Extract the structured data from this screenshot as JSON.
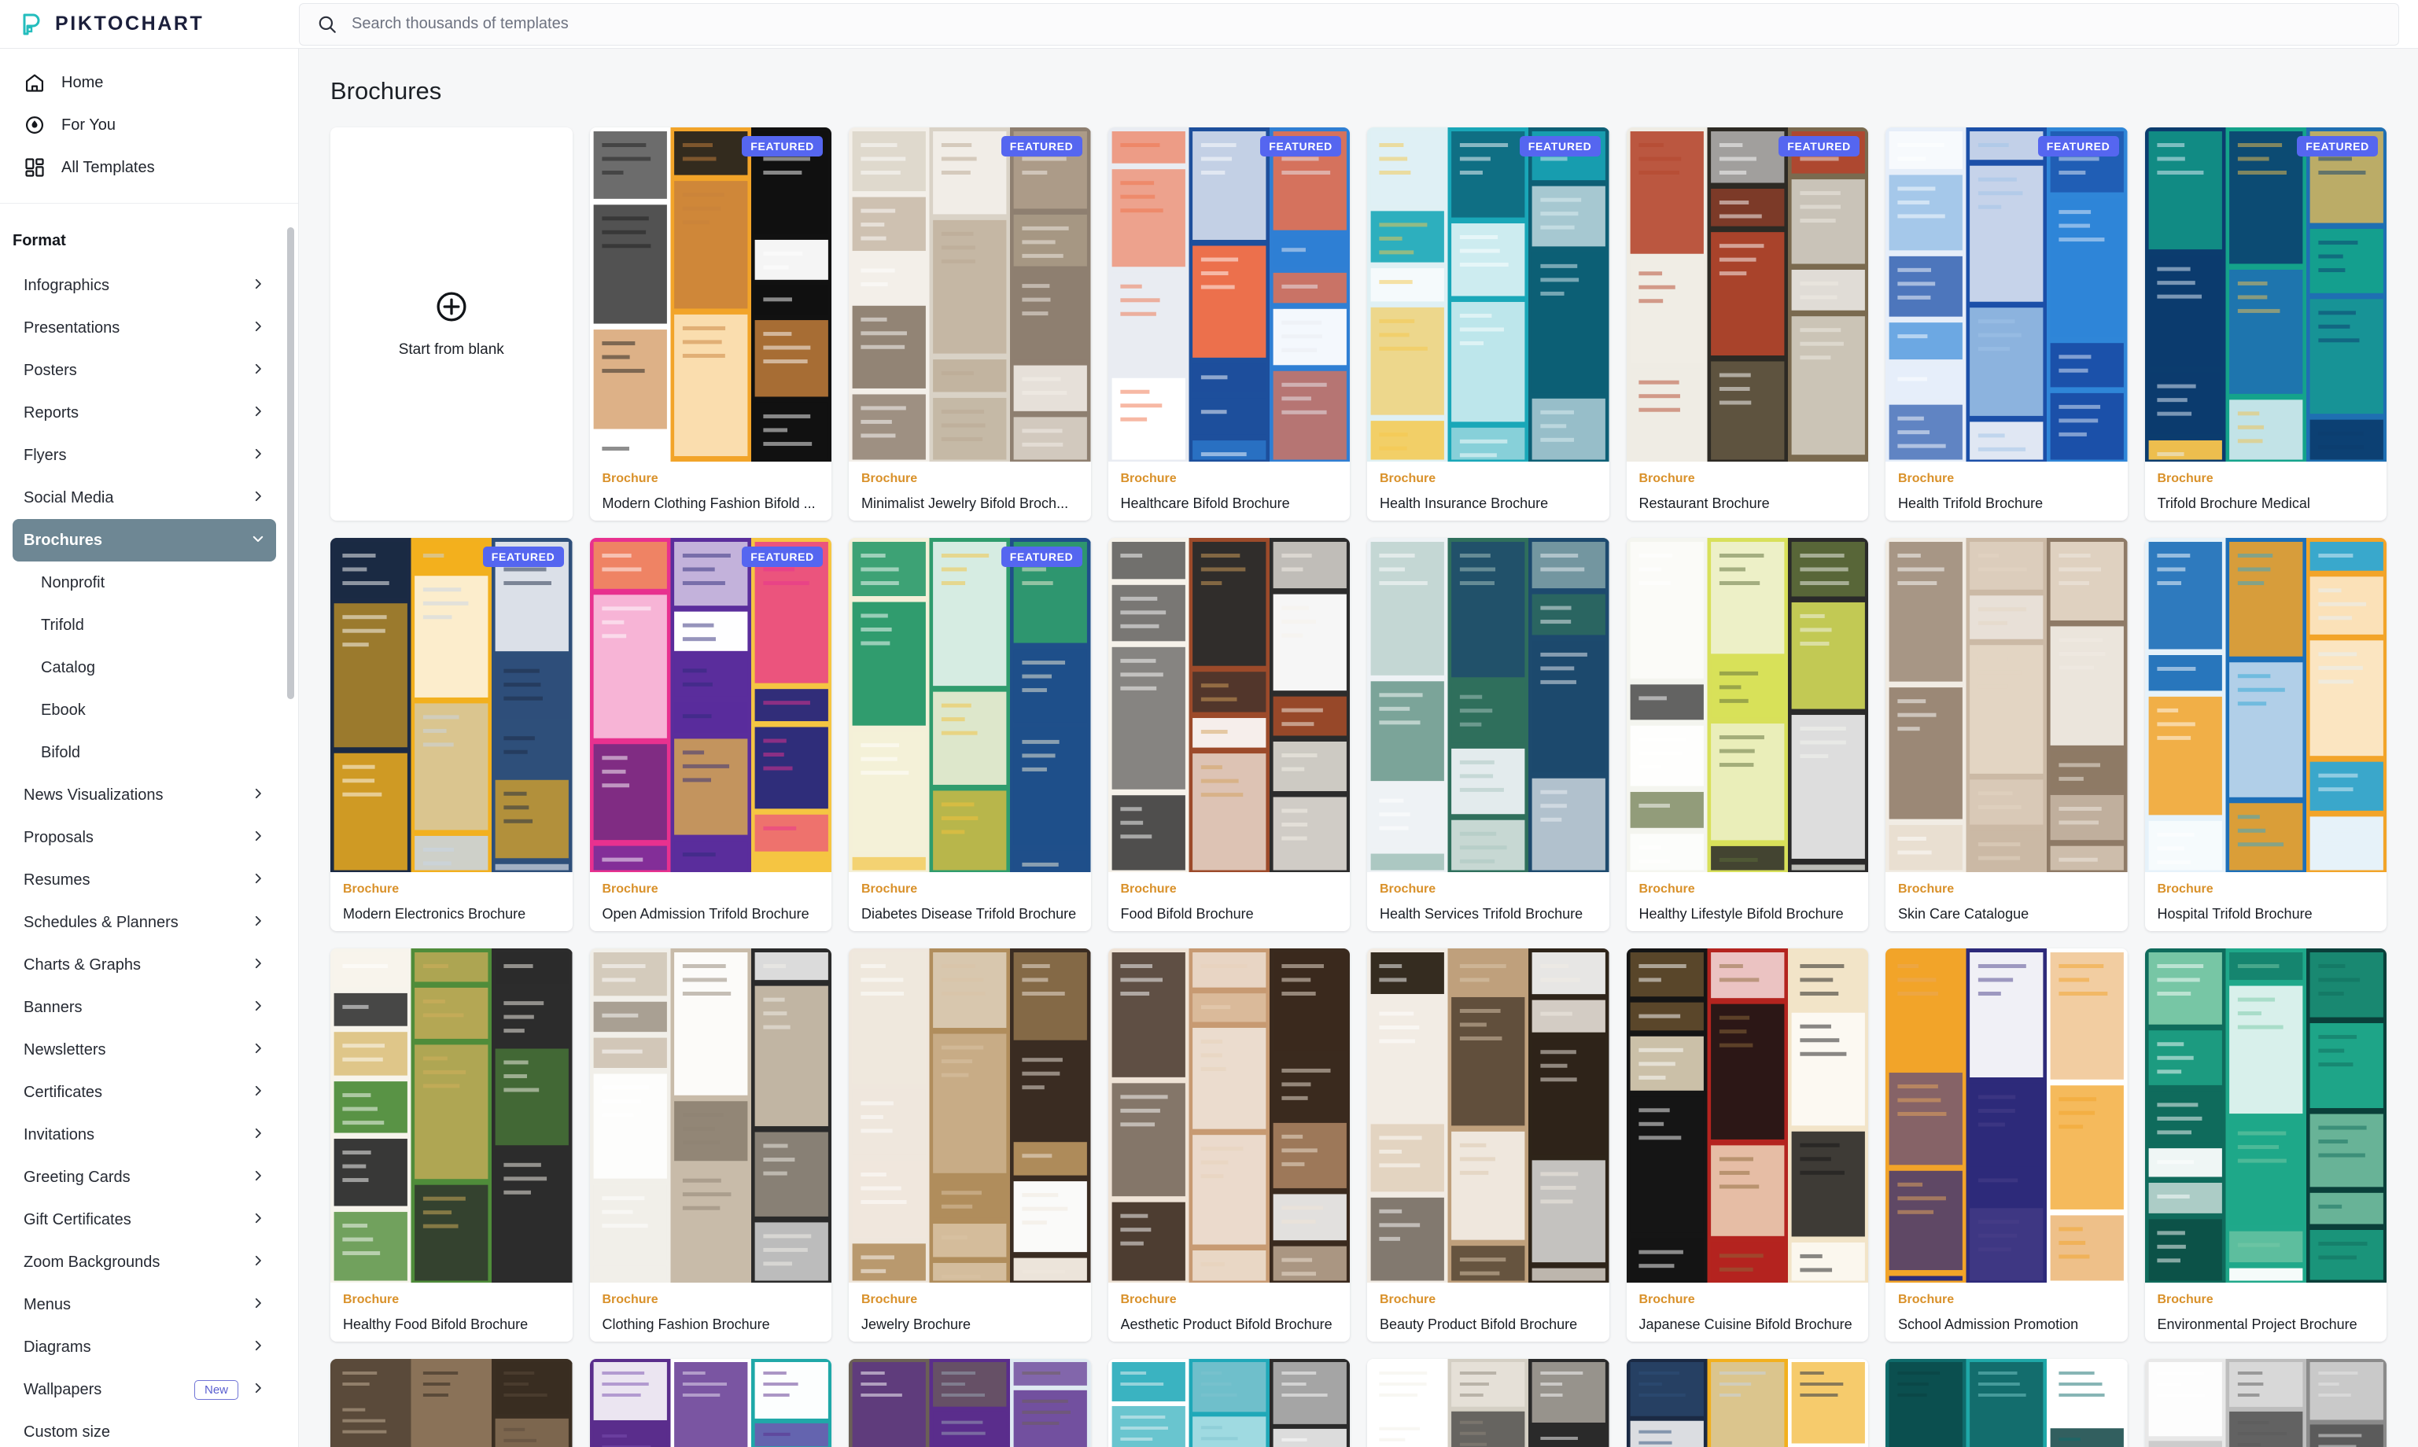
{
  "brand": {
    "name": "PIKTOCHART",
    "logo_icon": "piktochart-logo-icon"
  },
  "search": {
    "placeholder": "Search thousands of templates",
    "value": "",
    "icon": "search-icon"
  },
  "sidebar": {
    "primary": [
      {
        "label": "Home",
        "icon": "home-icon"
      },
      {
        "label": "For You",
        "icon": "flame-icon"
      },
      {
        "label": "All Templates",
        "icon": "grid-icon"
      }
    ],
    "section_title": "Format",
    "formats": [
      {
        "label": "Infographics",
        "chevron": "chevron-right-icon",
        "active": false
      },
      {
        "label": "Presentations",
        "chevron": "chevron-right-icon",
        "active": false
      },
      {
        "label": "Posters",
        "chevron": "chevron-right-icon",
        "active": false
      },
      {
        "label": "Reports",
        "chevron": "chevron-right-icon",
        "active": false
      },
      {
        "label": "Flyers",
        "chevron": "chevron-right-icon",
        "active": false
      },
      {
        "label": "Social Media",
        "chevron": "chevron-right-icon",
        "active": false
      },
      {
        "label": "Brochures",
        "chevron": "chevron-down-icon",
        "active": true
      },
      {
        "label": "News Visualizations",
        "chevron": "chevron-right-icon",
        "active": false
      },
      {
        "label": "Proposals",
        "chevron": "chevron-right-icon",
        "active": false
      },
      {
        "label": "Resumes",
        "chevron": "chevron-right-icon",
        "active": false
      },
      {
        "label": "Schedules & Planners",
        "chevron": "chevron-right-icon",
        "active": false
      },
      {
        "label": "Charts & Graphs",
        "chevron": "chevron-right-icon",
        "active": false
      },
      {
        "label": "Banners",
        "chevron": "chevron-right-icon",
        "active": false
      },
      {
        "label": "Newsletters",
        "chevron": "chevron-right-icon",
        "active": false
      },
      {
        "label": "Certificates",
        "chevron": "chevron-right-icon",
        "active": false
      },
      {
        "label": "Invitations",
        "chevron": "chevron-right-icon",
        "active": false
      },
      {
        "label": "Greeting Cards",
        "chevron": "chevron-right-icon",
        "active": false
      },
      {
        "label": "Gift Certificates",
        "chevron": "chevron-right-icon",
        "active": false
      },
      {
        "label": "Zoom Backgrounds",
        "chevron": "chevron-right-icon",
        "active": false
      },
      {
        "label": "Menus",
        "chevron": "chevron-right-icon",
        "active": false
      },
      {
        "label": "Diagrams",
        "chevron": "chevron-right-icon",
        "active": false
      },
      {
        "label": "Wallpapers",
        "chevron": "chevron-right-icon",
        "active": false,
        "badge": "New"
      }
    ],
    "brochure_subitems": [
      "Nonprofit",
      "Trifold",
      "Catalog",
      "Ebook",
      "Bifold"
    ],
    "custom_size": "Custom size"
  },
  "main": {
    "title": "Brochures",
    "blank_card": {
      "label": "Start from blank",
      "icon": "plus-circle-icon"
    },
    "featured_label": "FEATURED",
    "kind_label": "Brochure",
    "accent_kind_color": "#d9912a",
    "featured_badge_color": "#5566f0",
    "active_nav_color": "#6e8794",
    "templates": [
      {
        "name": "Modern Clothing Fashion Bifold ...",
        "kind": "Brochure",
        "featured": true,
        "art": "fashion"
      },
      {
        "name": "Minimalist Jewelry Bifold Broch...",
        "kind": "Brochure",
        "featured": true,
        "art": "jewelry"
      },
      {
        "name": "Healthcare Bifold Brochure",
        "kind": "Brochure",
        "featured": true,
        "art": "healthcare"
      },
      {
        "name": "Health Insurance Brochure",
        "kind": "Brochure",
        "featured": true,
        "art": "insurance"
      },
      {
        "name": "Restaurant Brochure",
        "kind": "Brochure",
        "featured": true,
        "art": "restaurant"
      },
      {
        "name": "Health Trifold Brochure",
        "kind": "Brochure",
        "featured": true,
        "art": "healthtri"
      },
      {
        "name": "Trifold Brochure Medical",
        "kind": "Brochure",
        "featured": true,
        "art": "medical"
      },
      {
        "name": "Modern Electronics Brochure",
        "kind": "Brochure",
        "featured": true,
        "art": "electronics"
      },
      {
        "name": "Open Admission Trifold Brochure",
        "kind": "Brochure",
        "featured": true,
        "art": "admission"
      },
      {
        "name": "Diabetes Disease Trifold Brochure",
        "kind": "Brochure",
        "featured": true,
        "art": "diabetes"
      },
      {
        "name": "Food Bifold Brochure",
        "kind": "Brochure",
        "featured": false,
        "art": "food"
      },
      {
        "name": "Health Services Trifold Brochure",
        "kind": "Brochure",
        "featured": false,
        "art": "healthsvc"
      },
      {
        "name": "Healthy Lifestyle Bifold Brochure",
        "kind": "Brochure",
        "featured": false,
        "art": "lifestyle"
      },
      {
        "name": "Skin Care Catalogue",
        "kind": "Brochure",
        "featured": false,
        "art": "skincare"
      },
      {
        "name": "Hospital Trifold Brochure",
        "kind": "Brochure",
        "featured": false,
        "art": "hospital"
      },
      {
        "name": "Healthy Food Bifold Brochure",
        "kind": "Brochure",
        "featured": false,
        "art": "healthyfood"
      },
      {
        "name": "Clothing Fashion Brochure",
        "kind": "Brochure",
        "featured": false,
        "art": "clothing"
      },
      {
        "name": "Jewelry Brochure",
        "kind": "Brochure",
        "featured": false,
        "art": "jewelry2"
      },
      {
        "name": "Aesthetic Product Bifold Brochure",
        "kind": "Brochure",
        "featured": false,
        "art": "aesthetic"
      },
      {
        "name": "Beauty Product Bifold Brochure",
        "kind": "Brochure",
        "featured": false,
        "art": "beauty"
      },
      {
        "name": "Japanese Cuisine Bifold Brochure",
        "kind": "Brochure",
        "featured": false,
        "art": "japanese"
      },
      {
        "name": "School Admission Promotion",
        "kind": "Brochure",
        "featured": false,
        "art": "school"
      },
      {
        "name": "Environmental Project Brochure",
        "kind": "Brochure",
        "featured": false,
        "art": "ocean"
      }
    ],
    "partial_row_arts": [
      "shelf",
      "purple",
      "city",
      "aboutus",
      "company",
      "connect",
      "teal",
      "gray"
    ]
  }
}
